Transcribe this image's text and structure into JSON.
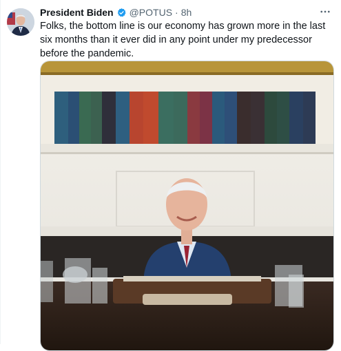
{
  "tweet": {
    "author_name": "President Biden",
    "handle": "@POTUS",
    "separator": "·",
    "time": "8h",
    "more_icon": "more-horizontal-icon",
    "verified_icon": "verified-badge-icon",
    "text": "Folks, the bottom line is our economy has grown more in the last six months than it ever did in any point under my predecessor before the pandemic."
  },
  "colors": {
    "verified_badge": "#1d9bf0",
    "text_primary": "#0f1419",
    "text_secondary": "#536471"
  }
}
